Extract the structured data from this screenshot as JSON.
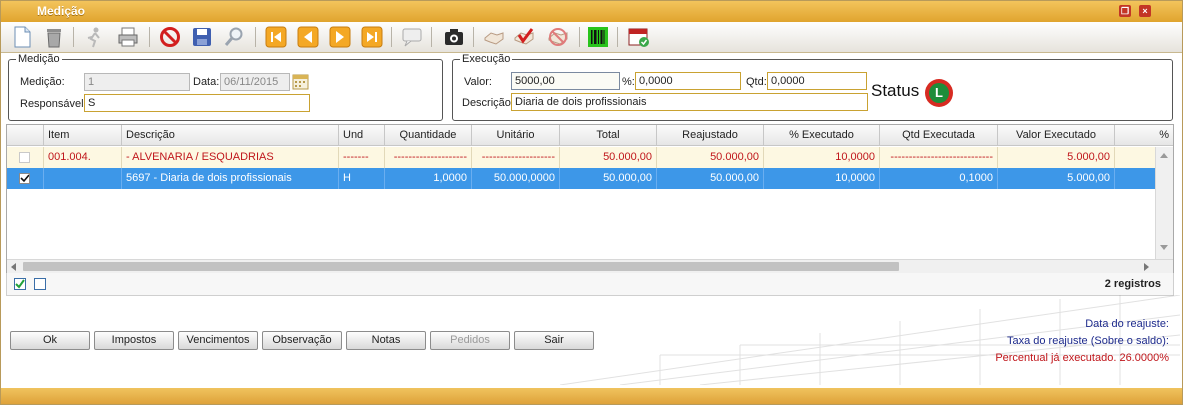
{
  "window": {
    "title": "Medição"
  },
  "medicao_group": {
    "legend": "Medição",
    "medicao_label": "Medição:",
    "medicao_value": "1",
    "data_label": "Data:",
    "data_value": "06/11/2015",
    "responsavel_label": "Responsável:",
    "responsavel_value": "S"
  },
  "execucao_group": {
    "legend": "Execução",
    "valor_label": "Valor:",
    "valor_value": "5000,00",
    "pct_label": "%:",
    "pct_value": "0,0000",
    "qtd_label": "Qtd:",
    "qtd_value": "0,0000",
    "descricao_label": "Descrição.",
    "descricao_value": "Diaria de dois profissionais",
    "status_label": "Status",
    "status_badge": "L"
  },
  "grid": {
    "columns": [
      "Item",
      "Descrição",
      "Und",
      "Quantidade",
      "Unitário",
      "Total",
      "Reajustado",
      "% Executado",
      "Qtd Executada",
      "Valor Executado",
      "%"
    ],
    "rows": [
      {
        "item": "001.004.",
        "descricao": "- ALVENARIA / ESQUADRIAS",
        "und": "-------",
        "quantidade": "--------------------",
        "unitario": "--------------------",
        "total": "50.000,00",
        "reajustado": "50.000,00",
        "pct_exec": "10,0000",
        "qtd_exec": "----------------------------",
        "valor_exec": "5.000,00"
      },
      {
        "item": "",
        "descricao": "5697 - Diaria de dois profissionais",
        "und": "H",
        "quantidade": "1,0000",
        "unitario": "50.000,0000",
        "total": "50.000,00",
        "reajustado": "50.000,00",
        "pct_exec": "10,0000",
        "qtd_exec": "0,1000",
        "valor_exec": "5.000,00"
      }
    ],
    "record_count": "2 registros"
  },
  "buttons": {
    "ok": "Ok",
    "impostos": "Impostos",
    "vencimentos": "Vencimentos",
    "observacao": "Observação",
    "notas": "Notas",
    "pedidos": "Pedidos",
    "sair": "Sair"
  },
  "info": {
    "data_reajuste": "Data do reajuste:",
    "taxa_reajuste": "Taxa do reajuste (Sobre o saldo):",
    "percentual": "Percentual já executado. 26.0000%"
  },
  "colors": {
    "title_bar": "#e8b040",
    "selected_row": "#3d97e8",
    "group_row_text": "#c0161b",
    "info_blue": "#1d2a8c",
    "info_red": "#c0161b"
  },
  "toolbar_icons": [
    "new-document-icon",
    "trash-icon",
    "run-icon",
    "print-icon",
    "cancel-icon",
    "save-icon",
    "search-icon",
    "first-icon",
    "previous-icon",
    "next-icon",
    "last-icon",
    "chat-icon",
    "camera-icon",
    "handshake-icon",
    "approve-icon",
    "reject-icon",
    "barcode-icon",
    "calendar-ok-icon"
  ]
}
